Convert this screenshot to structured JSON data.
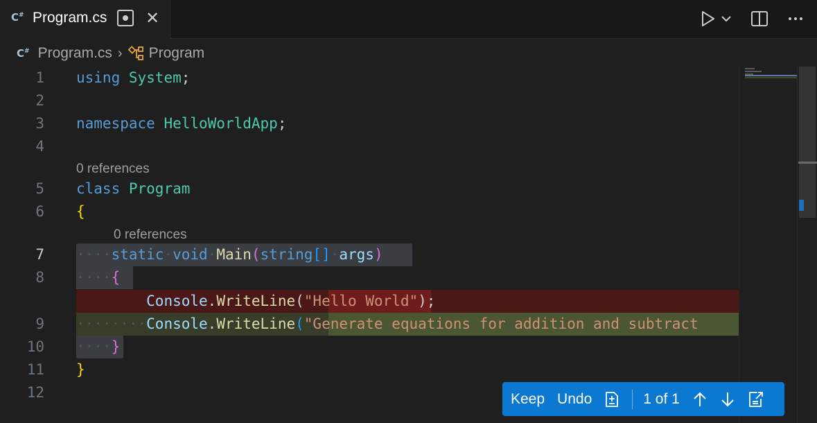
{
  "tab": {
    "label": "Program.cs",
    "icon": "C#"
  },
  "breadcrumb": {
    "file": "Program.cs",
    "symbol": "Program"
  },
  "editor": {
    "lens_main": "0 references",
    "lens_class": "0 references",
    "line_numbers": [
      "1",
      "2",
      "3",
      "4",
      "5",
      "6",
      "7",
      "8",
      "9",
      "10",
      "11",
      "12"
    ],
    "code": {
      "using_kw": "using",
      "system": "System",
      "semi": ";",
      "ns_kw": "namespace",
      "ns_name": "HelloWorldApp",
      "class_kw": "class",
      "class_name": "Program",
      "open_brace": "{",
      "close_brace": "}",
      "static_kw": "static",
      "void_kw": "void",
      "main": "Main",
      "lparen": "(",
      "string_kw": "string",
      "brackets": "[]",
      "args": "args",
      "rparen": ")",
      "console": "Console",
      "dot": ".",
      "writeline": "WriteLine",
      "removed_string": "\"Hello World\"",
      "removed_tail": ");",
      "added_string": "\"Generate equations for addition and subtract"
    }
  },
  "chat_toolbar": {
    "keep": "Keep",
    "undo": "Undo",
    "counter": "1 of 1"
  },
  "colors": {
    "accent": "#0b78d1",
    "removed_bg": "#4b1818",
    "added_bg": "#373d29"
  }
}
